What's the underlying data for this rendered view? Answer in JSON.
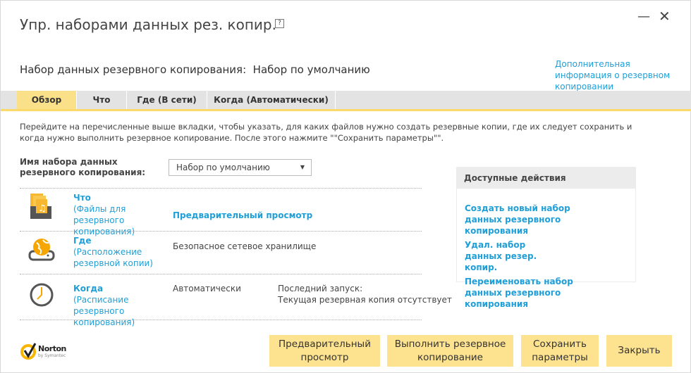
{
  "window": {
    "title": "Упр. наборами данных рез. копир.",
    "help": "?",
    "minimize": "—",
    "close": "✕"
  },
  "header": {
    "subtitle": "Набор данных резервного копирования:  Набор по умолчанию",
    "more_info": "Дополнительная информация о резервном копировании"
  },
  "tabs": [
    {
      "label": "Обзор"
    },
    {
      "label": "Что"
    },
    {
      "label": "Где (В сети)"
    },
    {
      "label": "Когда (Автоматически)"
    }
  ],
  "intro": "Перейдите на перечисленные выше вкладки, чтобы указать, для каких файлов нужно создать резервные копии, где их следует сохранить и когда нужно выполнить резервное копирование. После этого нажмите \"\"Сохранить параметры\"\".",
  "set_name": {
    "label": "Имя набора данных резервного копирования:",
    "value": "Набор по умолчанию"
  },
  "rows": [
    {
      "title": "Что",
      "desc": "(Файлы для резервного копирования)",
      "value": "Предварительный просмотр"
    },
    {
      "title": "Где",
      "desc": "(Расположение резервной копии)",
      "value": "Безопасное сетевое хранилище"
    },
    {
      "title": "Когда",
      "desc": "(Расписание резервного копирования)",
      "value": "Автоматически",
      "last_run_label": "Последний запуск:",
      "last_run_value": "Текущая резервная копия отсутствует"
    }
  ],
  "actions": {
    "title": "Доступные действия",
    "items": [
      "Создать новый набор данных резервного копирования",
      "Удал. набор данных резер. копир.",
      "Переименовать набор данных резервного копирования"
    ]
  },
  "brand": {
    "name": "Norton",
    "sub": "by Symantec"
  },
  "buttons": {
    "preview": "Предварительный просмотр",
    "run": "Выполнить резервное копирование",
    "save": "Сохранить параметры",
    "close": "Закрыть"
  },
  "colors": {
    "accent": "#fde28f",
    "link": "#1e9fd8"
  }
}
